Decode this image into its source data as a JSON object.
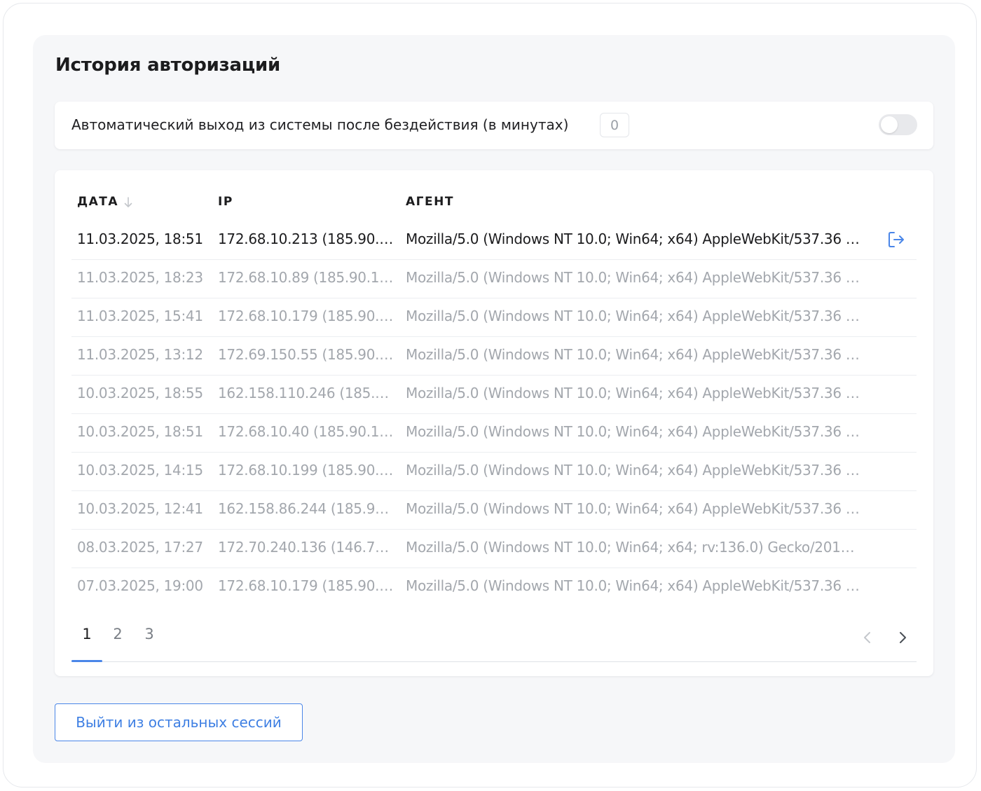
{
  "section": {
    "title": "История авторизаций"
  },
  "autologout": {
    "label": "Автоматический выход из системы после бездействия (в минутах)",
    "minutes_value": "0",
    "toggle_enabled": false
  },
  "history": {
    "columns": {
      "date": "ДАТА",
      "ip": "IP",
      "agent": "АГЕНТ"
    },
    "sort": {
      "column": "date",
      "icon": "arrow-down-icon"
    },
    "rows": [
      {
        "date": "11.03.2025, 18:51",
        "ip": "172.68.10.213 (185.90.102...",
        "agent": "Mozilla/5.0 (Windows NT 10.0; Win64; x64) AppleWebKit/537.36 (KHT...",
        "current": true
      },
      {
        "date": "11.03.2025, 18:23",
        "ip": "172.68.10.89 (185.90.102....",
        "agent": "Mozilla/5.0 (Windows NT 10.0; Win64; x64) AppleWebKit/537.36 (KHT...",
        "current": false
      },
      {
        "date": "11.03.2025, 15:41",
        "ip": "172.68.10.179 (185.90.102...",
        "agent": "Mozilla/5.0 (Windows NT 10.0; Win64; x64) AppleWebKit/537.36 (KHT...",
        "current": false
      },
      {
        "date": "11.03.2025, 13:12",
        "ip": "172.69.150.55 (185.90.102...",
        "agent": "Mozilla/5.0 (Windows NT 10.0; Win64; x64) AppleWebKit/537.36 (KHT...",
        "current": false
      },
      {
        "date": "10.03.2025, 18:55",
        "ip": "162.158.110.246 (185.90.1...",
        "agent": "Mozilla/5.0 (Windows NT 10.0; Win64; x64) AppleWebKit/537.36 (KHT...",
        "current": false
      },
      {
        "date": "10.03.2025, 18:51",
        "ip": "172.68.10.40 (185.90.102....",
        "agent": "Mozilla/5.0 (Windows NT 10.0; Win64; x64) AppleWebKit/537.36 (KHT...",
        "current": false
      },
      {
        "date": "10.03.2025, 14:15",
        "ip": "172.68.10.199 (185.90.102...",
        "agent": "Mozilla/5.0 (Windows NT 10.0; Win64; x64) AppleWebKit/537.36 (KHT...",
        "current": false
      },
      {
        "date": "10.03.2025, 12:41",
        "ip": "162.158.86.244 (185.90.1...",
        "agent": "Mozilla/5.0 (Windows NT 10.0; Win64; x64) AppleWebKit/537.36 (KHT...",
        "current": false
      },
      {
        "date": "08.03.2025, 17:27",
        "ip": "172.70.240.136 (146.70.17...",
        "agent": "Mozilla/5.0 (Windows NT 10.0; Win64; x64; rv:136.0) Gecko/2010010...",
        "current": false
      },
      {
        "date": "07.03.2025, 19:00",
        "ip": "172.68.10.179 (185.90.102...",
        "agent": "Mozilla/5.0 (Windows NT 10.0; Win64; x64) AppleWebKit/537.36 (KHT...",
        "current": false
      }
    ],
    "row_action_icon": "logout-icon"
  },
  "pagination": {
    "pages": [
      "1",
      "2",
      "3"
    ],
    "active_page": "1",
    "prev_icon": "chevron-left-icon",
    "next_icon": "chevron-right-icon"
  },
  "actions": {
    "terminate_label": "Выйти из остальных сессий"
  },
  "colors": {
    "accent": "#4a86e8",
    "text_primary": "#1c1c1e",
    "text_muted": "#a3a7ad",
    "panel_bg": "#f6f7f9"
  }
}
